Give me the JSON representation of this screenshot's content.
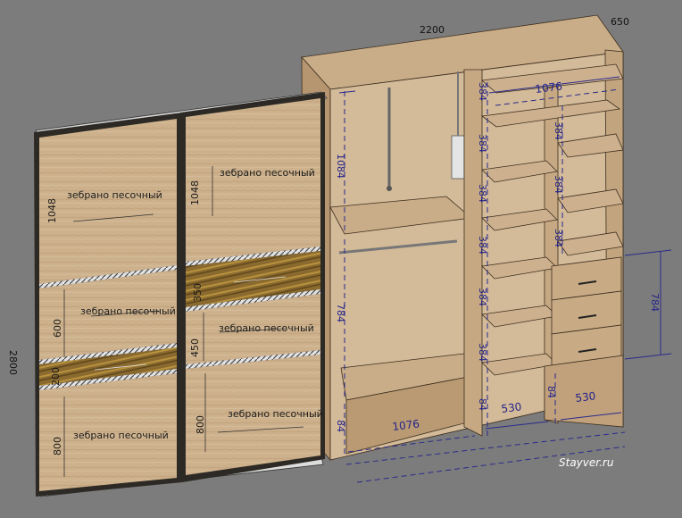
{
  "dimensions": {
    "total_width": "2200",
    "depth": "650",
    "total_height": "2800"
  },
  "doors": {
    "left": {
      "panel_top_label": "зебрано песочный",
      "panel_top_dim": "1048",
      "panel_mid_label": "зебрано песочный",
      "panel_mid_dim": "600",
      "insert_dim": "200",
      "panel_bottom_label": "зебрано песочный",
      "panel_bottom_dim": "800"
    },
    "right": {
      "panel_top_label": "зебрано песочный",
      "panel_top_dim": "1048",
      "insert_dim": "350",
      "panel_mid_label": "зебрано песочный",
      "panel_mid_dim": "450",
      "panel_bottom_label": "зебрано песочный",
      "panel_bottom_dim": "800"
    }
  },
  "cabinet": {
    "top_shelf_width": "1076",
    "upper_rod_height": "1084",
    "lower_rod_height": "784",
    "plinth_height": "84",
    "bottom_left_width": "1076",
    "bottom_mid_width": "530",
    "bottom_right_width": "530",
    "middle_shelf_pitch": [
      "384",
      "384",
      "384",
      "384",
      "384",
      "384"
    ],
    "middle_plinth": "84",
    "right_shelf_pitch": [
      "384",
      "384",
      "384"
    ],
    "right_plinth": "84",
    "drawers_height": "784"
  },
  "watermark": "Stayver.ru",
  "colors": {
    "background": "#7c7c7c",
    "laminate": "#c8ab85",
    "insert": "#8a6a2f",
    "dimension_line": "#2a2a8c"
  }
}
